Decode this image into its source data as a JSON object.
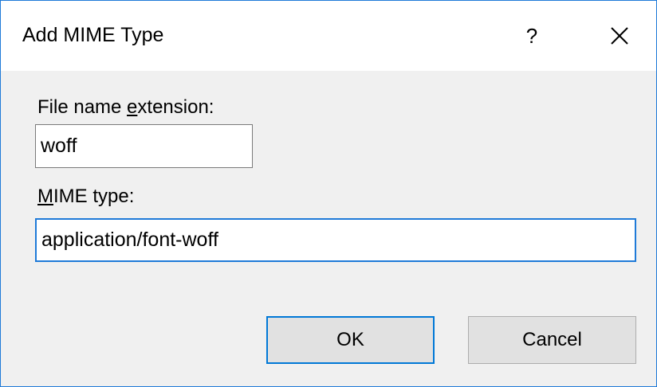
{
  "window": {
    "title": "Add MIME Type",
    "help_label": "?",
    "close_icon": "close-icon"
  },
  "form": {
    "extension_label_pre": "File name ",
    "extension_label_key": "e",
    "extension_label_post": "xtension:",
    "extension_value": "woff",
    "mime_label_key": "M",
    "mime_label_post": "IME type:",
    "mime_value": "application/font-woff"
  },
  "buttons": {
    "ok_label": "OK",
    "cancel_label": "Cancel"
  },
  "colors": {
    "accent": "#0078d7",
    "title_background": "#ffffff",
    "dialog_background": "#f0f0f0"
  }
}
